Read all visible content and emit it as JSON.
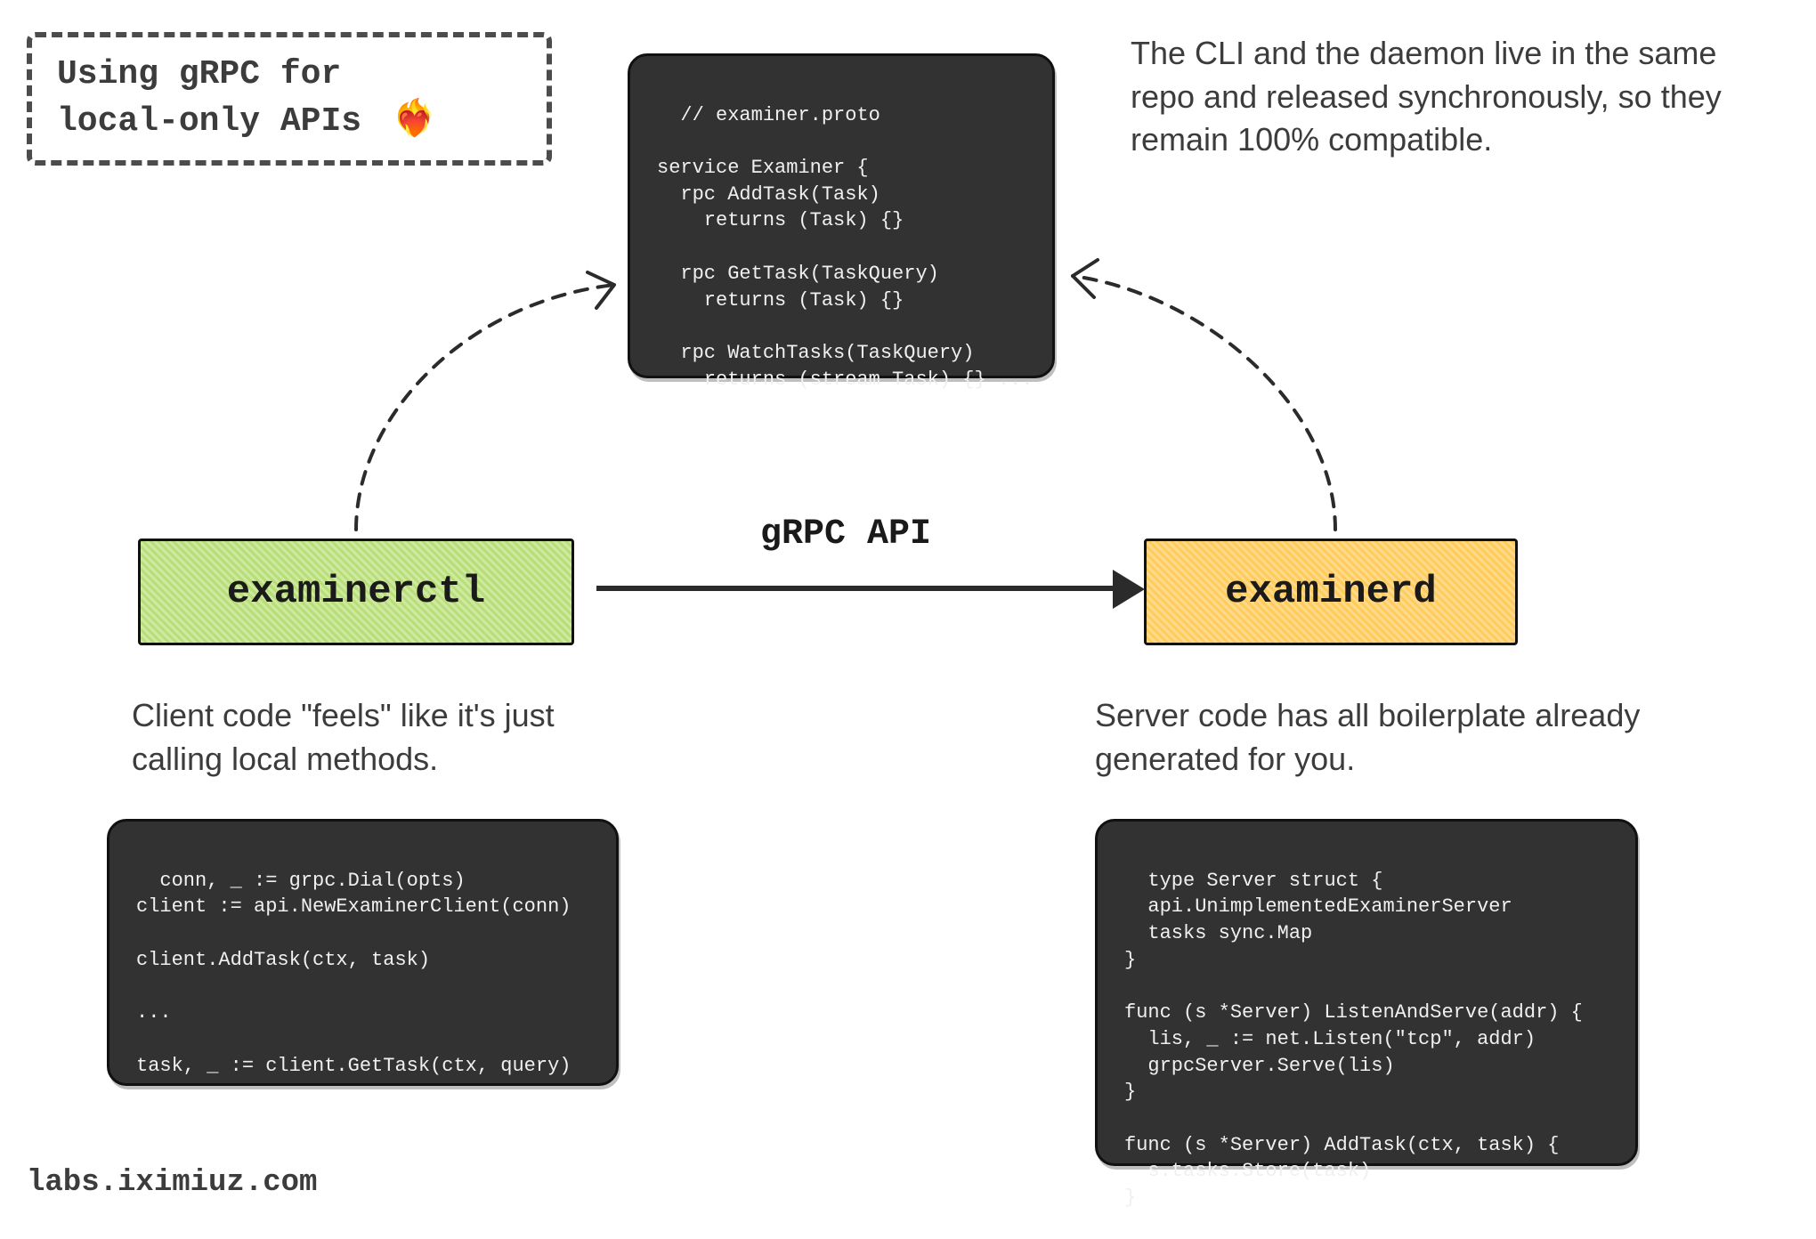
{
  "title": {
    "line1": "Using gRPC for",
    "line2": "local-only APIs",
    "emoji": "❤️‍🔥"
  },
  "note_top_right": "The CLI and the daemon live in the same repo and released synchronously, so they remain 100% compatible.",
  "proto_code": "// examiner.proto\n\nservice Examiner {\n  rpc AddTask(Task)\n    returns (Task) {}\n\n  rpc GetTask(TaskQuery)\n    returns (Task) {}\n\n  rpc WatchTasks(TaskQuery)\n    returns (stream Task) {} ...",
  "api_label": "gRPC API",
  "boxes": {
    "client_label": "examinerctl",
    "server_label": "examinerd"
  },
  "client": {
    "caption": "Client code \"feels\" like it's just calling local methods.",
    "code": "conn, _ := grpc.Dial(opts)\nclient := api.NewExaminerClient(conn)\n\nclient.AddTask(ctx, task)\n\n...\n\ntask, _ := client.GetTask(ctx, query)"
  },
  "server": {
    "caption": "Server code has all boilerplate already generated for you.",
    "code": "type Server struct {\n  api.UnimplementedExaminerServer\n  tasks sync.Map\n}\n\nfunc (s *Server) ListenAndServe(addr) {\n  lis, _ := net.Listen(\"tcp\", addr)\n  grpcServer.Serve(lis)\n}\n\nfunc (s *Server) AddTask(ctx, task) {\n  s.tasks.Store(task)\n}"
  },
  "footer": "labs.iximiuz.com"
}
